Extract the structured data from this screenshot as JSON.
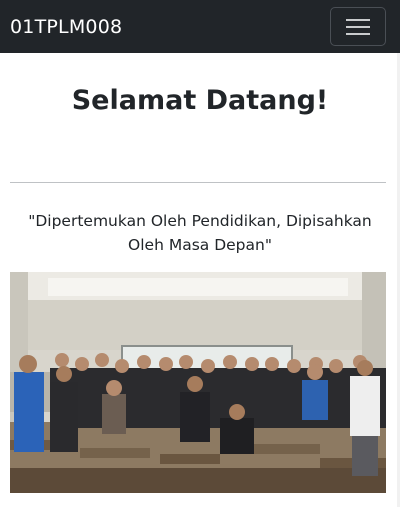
{
  "navbar": {
    "brand": "01TPLM008",
    "menu_icon": "hamburger-icon"
  },
  "main": {
    "title": "Selamat Datang!",
    "quote": "\"Dipertemukan Oleh Pendidikan, Dipisahkan Oleh Masa Depan\""
  },
  "colors": {
    "navbar_bg": "#212529",
    "text": "#212529",
    "divider": "#bfc2c5"
  }
}
